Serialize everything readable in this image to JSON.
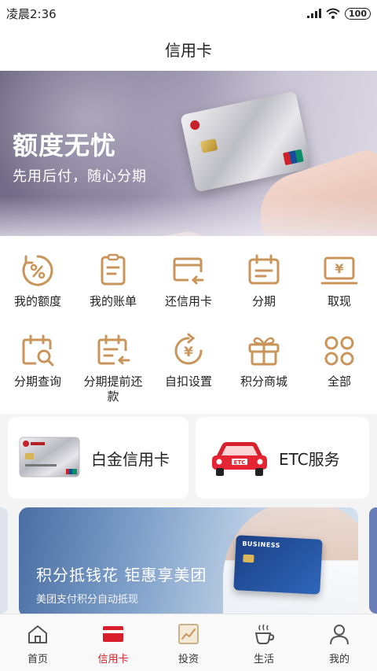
{
  "status_bar": {
    "time": "凌晨2:36",
    "battery": "100"
  },
  "header": {
    "title": "信用卡"
  },
  "banner": {
    "title": "额度无忧",
    "subtitle": "先用后付，随心分期"
  },
  "menu": [
    {
      "label": "我的额度",
      "icon": "quota-percent-icon"
    },
    {
      "label": "我的账单",
      "icon": "bill-icon"
    },
    {
      "label": "还信用卡",
      "icon": "repay-card-icon"
    },
    {
      "label": "分期",
      "icon": "installment-calendar-icon"
    },
    {
      "label": "取现",
      "icon": "cash-withdraw-icon"
    },
    {
      "label": "分期查询",
      "icon": "installment-query-icon"
    },
    {
      "label": "分期提前还\n款",
      "icon": "early-repay-icon"
    },
    {
      "label": "自扣设置",
      "icon": "auto-debit-icon"
    },
    {
      "label": "积分商城",
      "icon": "gift-icon"
    },
    {
      "label": "全部",
      "icon": "all-grid-icon"
    }
  ],
  "cards": {
    "platinum": {
      "label": "白金信用卡"
    },
    "etc": {
      "label": "ETC服务"
    }
  },
  "promo": {
    "title": "积分抵钱花  钜惠享美团",
    "subtitle": "美团支付积分自动抵现"
  },
  "nav": [
    {
      "label": "首页",
      "icon": "home-icon"
    },
    {
      "label": "信用卡",
      "icon": "credit-card-icon",
      "active": true
    },
    {
      "label": "投资",
      "icon": "investment-chart-icon"
    },
    {
      "label": "生活",
      "icon": "coffee-cup-icon"
    },
    {
      "label": "我的",
      "icon": "profile-icon"
    }
  ],
  "colors": {
    "accent": "#d81e2a",
    "icon_gold": "#c9955a"
  }
}
